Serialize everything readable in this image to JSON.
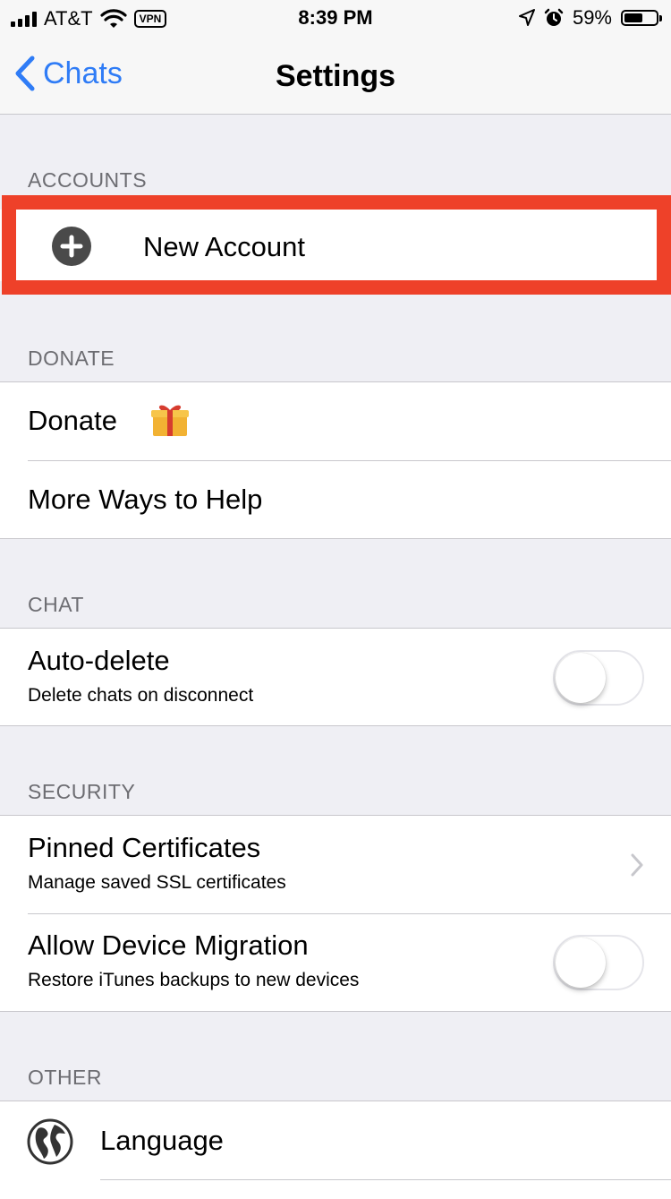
{
  "status_bar": {
    "carrier": "AT&T",
    "vpn": "VPN",
    "time": "8:39 PM",
    "battery": "59%",
    "battery_level": 0.59
  },
  "nav": {
    "back_label": "Chats",
    "title": "Settings"
  },
  "sections": {
    "accounts": {
      "header": "ACCOUNTS",
      "new_account": "New Account"
    },
    "donate": {
      "header": "DONATE",
      "donate": "Donate",
      "more_ways": "More Ways to Help"
    },
    "chat": {
      "header": "CHAT",
      "auto_delete_title": "Auto-delete",
      "auto_delete_sub": "Delete chats on disconnect",
      "auto_delete_on": false
    },
    "security": {
      "header": "SECURITY",
      "pinned_title": "Pinned Certificates",
      "pinned_sub": "Manage saved SSL certificates",
      "migration_title": "Allow Device Migration",
      "migration_sub": "Restore iTunes backups to new devices",
      "migration_on": false
    },
    "other": {
      "header": "OTHER",
      "language": "Language"
    }
  },
  "colors": {
    "accent": "#2f7cf6",
    "highlight": "#ee4129",
    "background": "#efeff4"
  }
}
